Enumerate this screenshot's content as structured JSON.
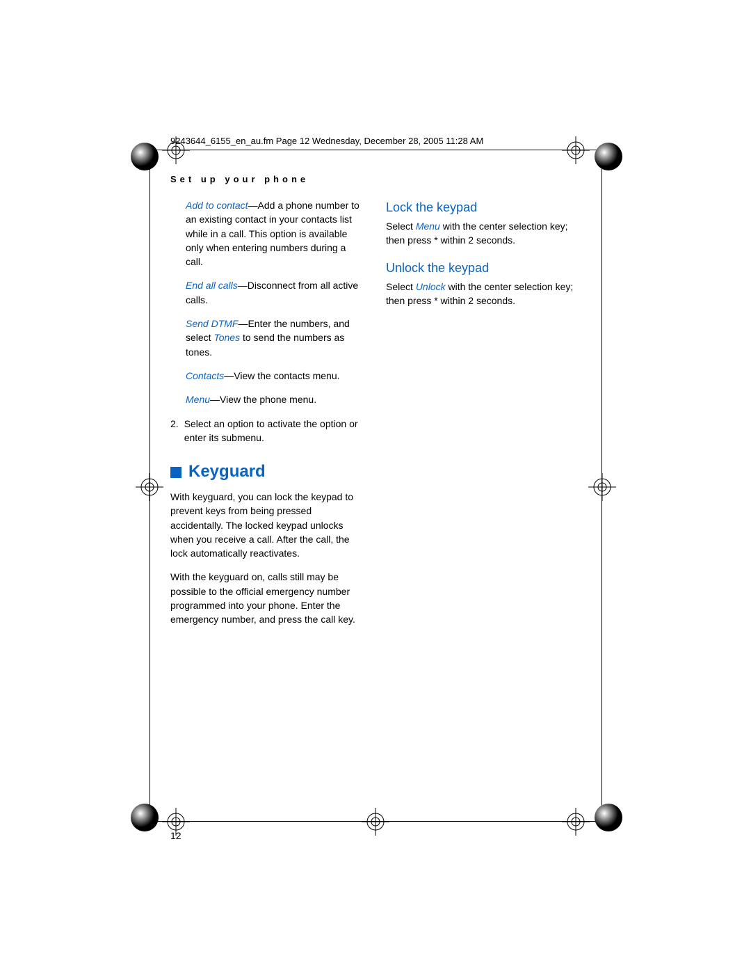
{
  "header": {
    "file_info": "9243644_6155_en_au.fm  Page 12  Wednesday, December 28, 2005  11:28 AM",
    "section": "Set up your phone"
  },
  "left_column": {
    "p1_em": "Add to contact",
    "p1_rest": "—Add a phone number to an existing contact in your contacts list while in a call. This option is available only when entering numbers during a call.",
    "p2_em": "End all calls",
    "p2_rest": "—Disconnect from all active calls.",
    "p3_em": "Send DTMF",
    "p3_mid": "—Enter the numbers, and select ",
    "p3_em2": "Tones",
    "p3_rest": " to send the numbers as tones.",
    "p4_em": "Contacts",
    "p4_rest": "—View the contacts menu.",
    "p5_em": "Menu",
    "p5_rest": "—View the phone menu.",
    "li_num": "2.",
    "li_text": "Select an option to activate the option or enter its submenu.",
    "keyguard_title": "Keyguard",
    "keyguard_p1": "With keyguard, you can lock the keypad to prevent keys from being pressed accidentally. The locked keypad unlocks when you receive a call. After the call, the lock automatically reactivates.",
    "keyguard_p2": "With the keyguard on, calls still may be possible to the official emergency number programmed into your phone. Enter the emergency number, and press the call key."
  },
  "right_column": {
    "h1": "Lock the keypad",
    "p1_pre": "Select ",
    "p1_em": "Menu",
    "p1_post": " with the center selection key; then press * within 2 seconds.",
    "h2": "Unlock the keypad",
    "p2_pre": "Select ",
    "p2_em": "Unlock",
    "p2_post": " with the center selection key; then press * within 2 seconds."
  },
  "page_number": "12"
}
